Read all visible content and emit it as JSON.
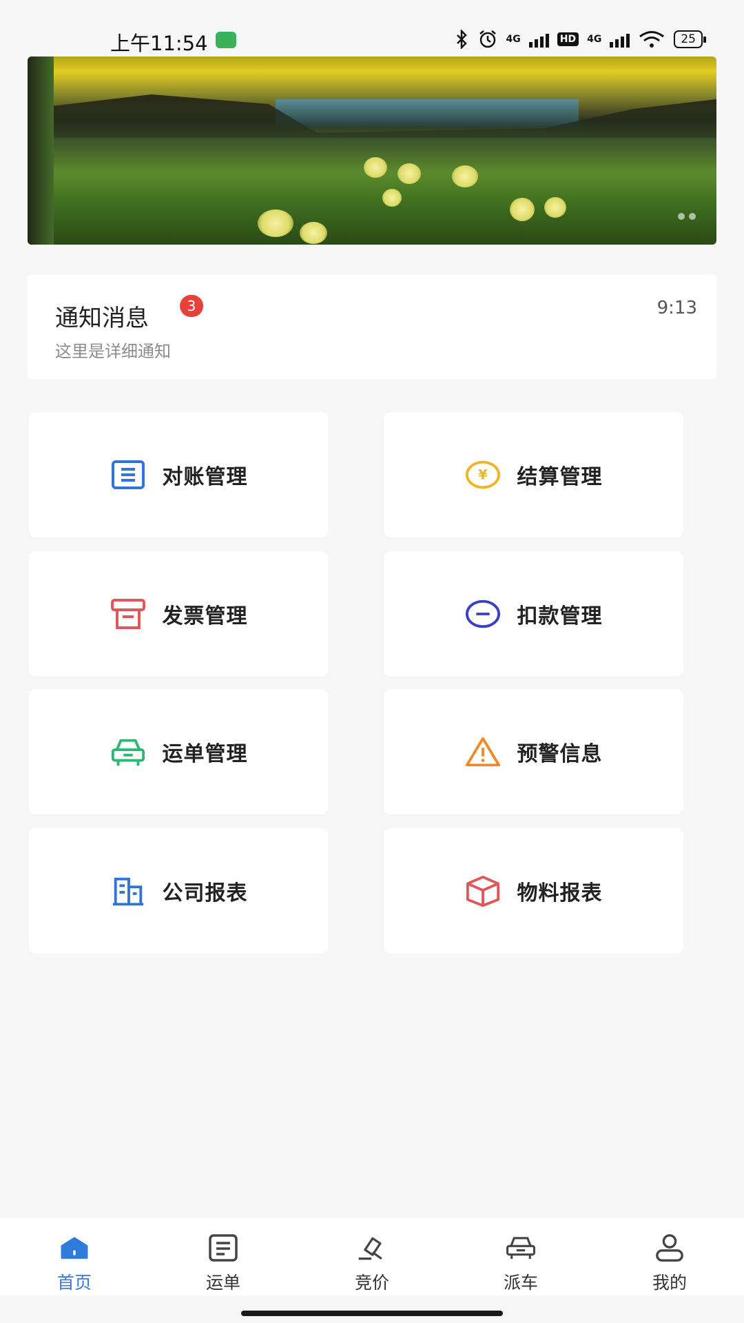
{
  "status_bar": {
    "time": "上午11:54",
    "network_1": "4G",
    "hd": "HD",
    "network_2": "4G",
    "battery": "25"
  },
  "banner": {
    "image": "dandelion-meadow-sunset-photo"
  },
  "notification": {
    "title": "通知消息",
    "badge_count": "3",
    "description": "这里是详细通知",
    "time": "9:13"
  },
  "menu": {
    "items": [
      {
        "label": "对账管理",
        "icon": "list-doc-icon",
        "color": "#2f74d6"
      },
      {
        "label": "结算管理",
        "icon": "yen-coin-icon",
        "color": "#f0b429"
      },
      {
        "label": "发票管理",
        "icon": "printer-icon",
        "color": "#e2565a"
      },
      {
        "label": "扣款管理",
        "icon": "minus-circle-icon",
        "color": "#3a3fc8"
      },
      {
        "label": "运单管理",
        "icon": "car-icon",
        "color": "#2cb774"
      },
      {
        "label": "预警信息",
        "icon": "warning-triangle-icon",
        "color": "#f08a26"
      },
      {
        "label": "公司报表",
        "icon": "building-icon",
        "color": "#2f74d6"
      },
      {
        "label": "物料报表",
        "icon": "box-icon",
        "color": "#e2565a"
      }
    ]
  },
  "tabbar": {
    "items": [
      {
        "label": "首页",
        "icon": "home-icon",
        "active": true
      },
      {
        "label": "运单",
        "icon": "document-icon",
        "active": false
      },
      {
        "label": "竞价",
        "icon": "gavel-icon",
        "active": false
      },
      {
        "label": "派车",
        "icon": "car-icon",
        "active": false
      },
      {
        "label": "我的",
        "icon": "user-icon",
        "active": false
      }
    ],
    "active_color": "#2e7bdb"
  }
}
